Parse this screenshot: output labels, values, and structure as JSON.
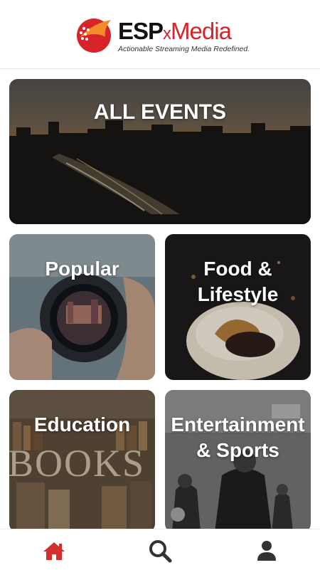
{
  "header": {
    "brand_prefix": "ESP",
    "brand_x": "x",
    "brand_suffix": "Media",
    "tagline": "Actionable Streaming Media Redefined."
  },
  "tiles": [
    {
      "label": "ALL EVENTS"
    },
    {
      "label": "Popular"
    },
    {
      "label_line1": "Food &",
      "label_line2": "Lifestyle"
    },
    {
      "label": "Education",
      "decor_text": "BOOKS"
    },
    {
      "label_line1": "Entertainment",
      "label_line2": "& Sports"
    }
  ],
  "bottom_nav": {
    "items": [
      {
        "icon": "home-icon",
        "active": true
      },
      {
        "icon": "search-icon",
        "active": false
      },
      {
        "icon": "user-icon",
        "active": false
      }
    ],
    "active_color": "#d32f2f",
    "inactive_color": "#333333"
  },
  "colors": {
    "brand_red": "#d8232a",
    "brand_orange": "#f28c28"
  }
}
